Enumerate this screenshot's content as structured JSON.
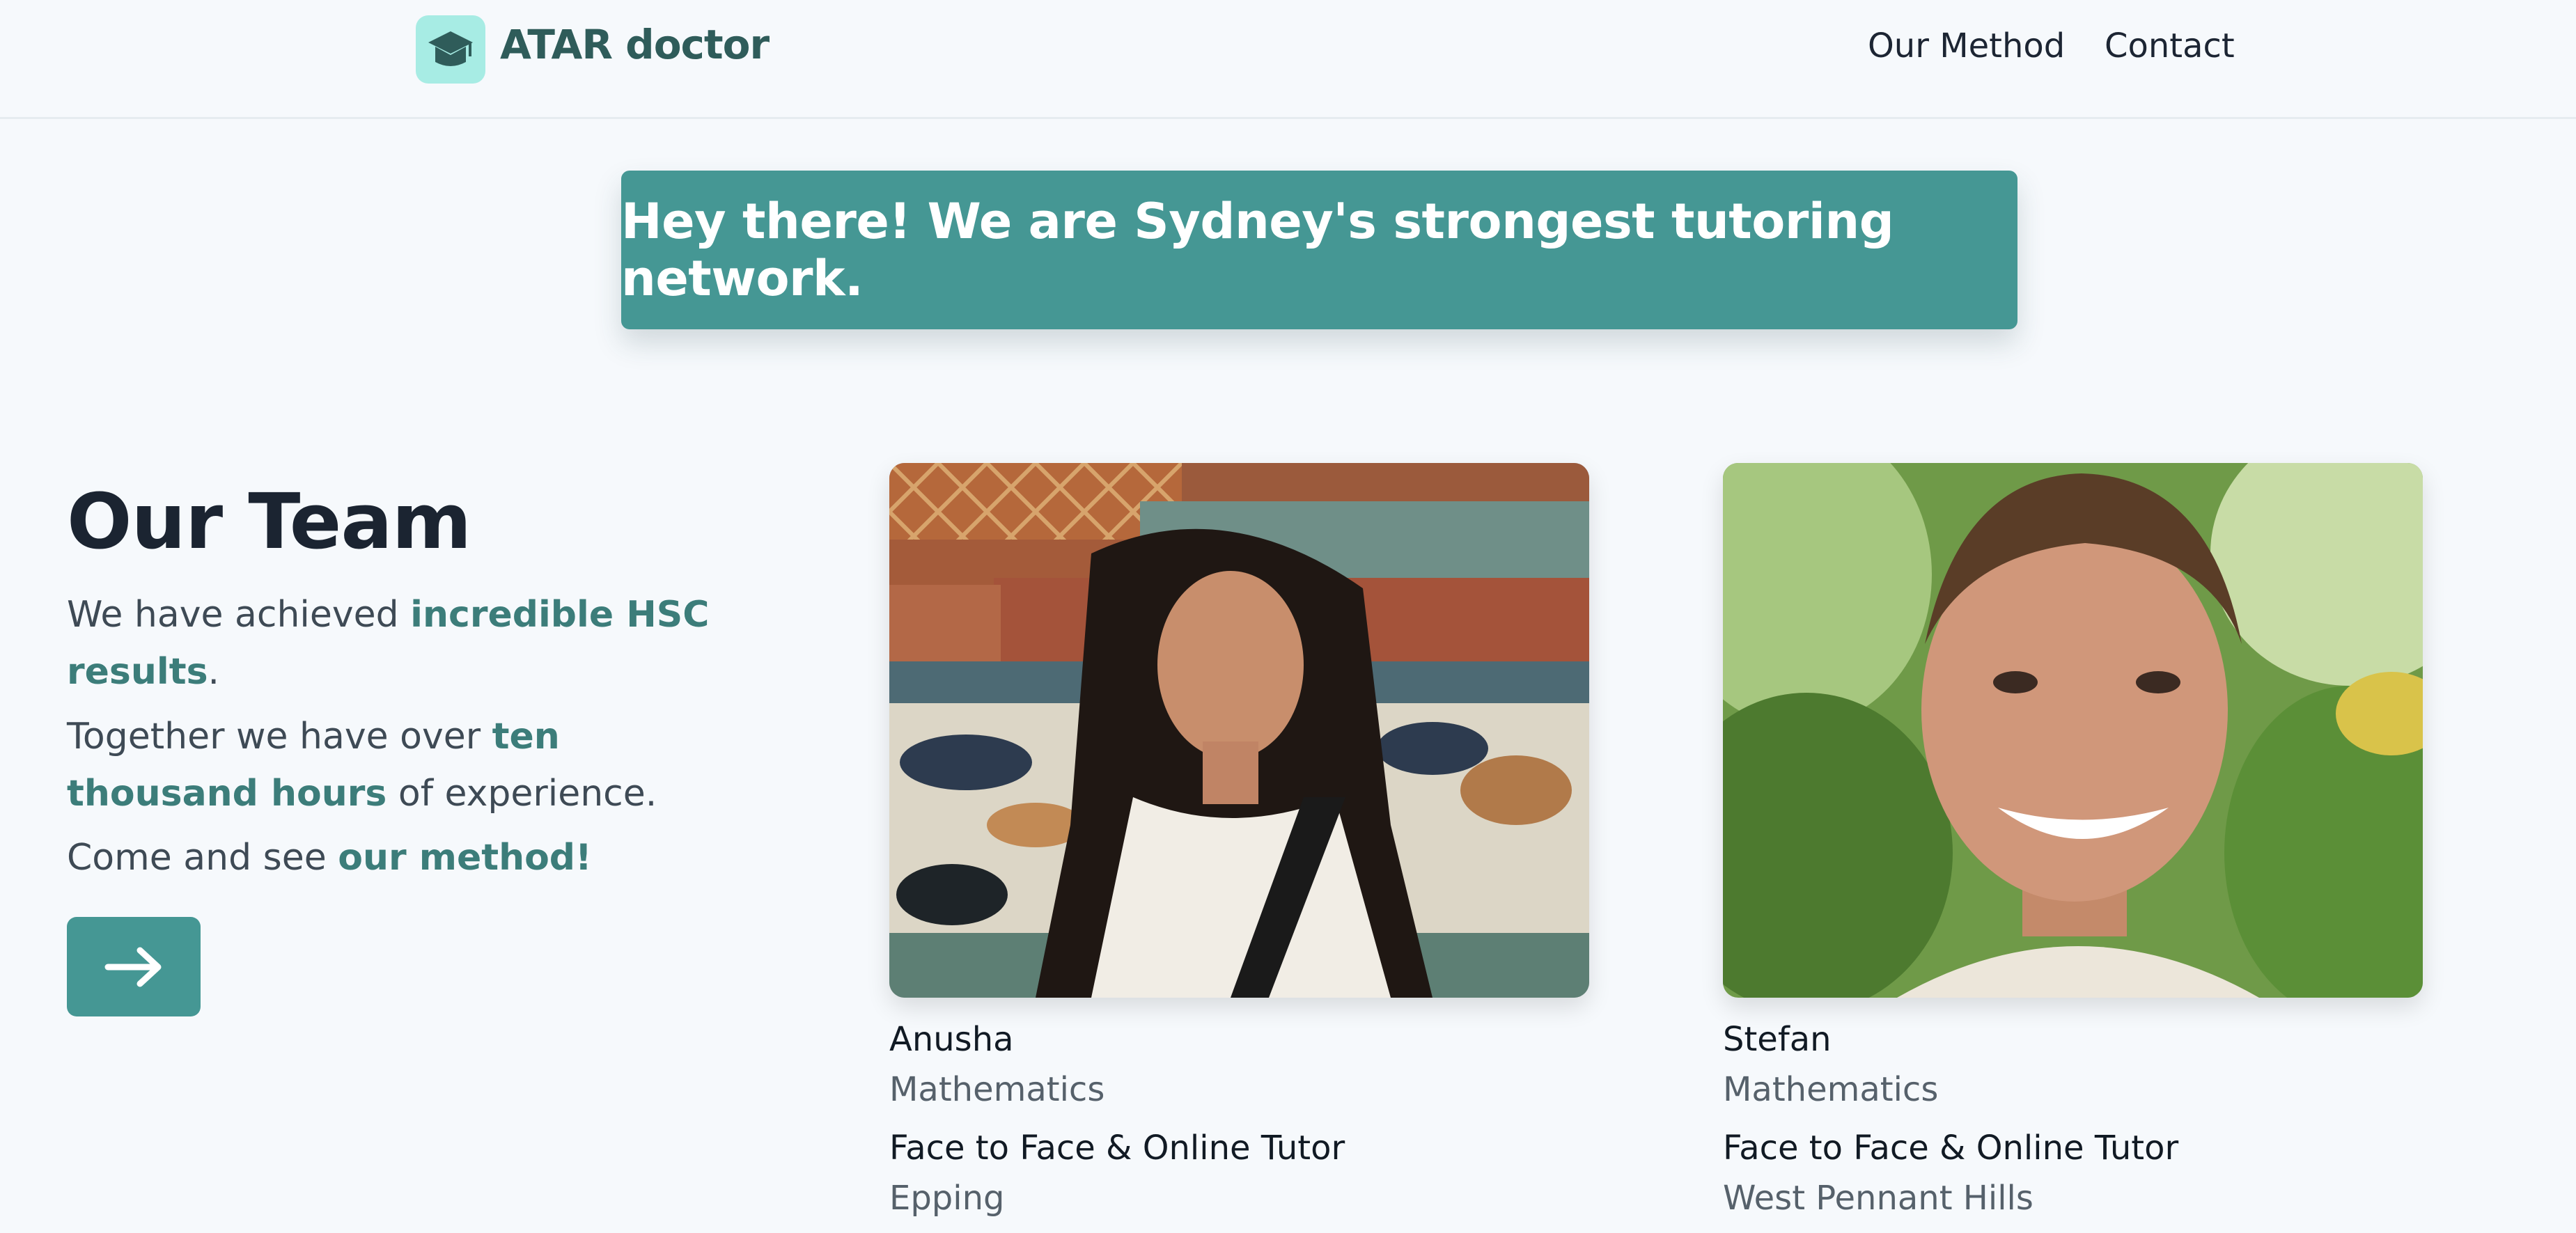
{
  "nav": {
    "brand": "ATAR doctor",
    "links": [
      "Our Method",
      "Contact"
    ]
  },
  "banner": {
    "text": "Hey there! We are Sydney's strongest tutoring network."
  },
  "team": {
    "title": "Our Team",
    "line1_pre": "We have achieved ",
    "line1_hl": "incredible HSC results",
    "line1_post": ".",
    "line2_pre": "Together we have over ",
    "line2_hl": "ten thousand hours",
    "line2_post": " of experience.",
    "line3_pre": "Come and see ",
    "line3_hl": "our method!"
  },
  "tutors": [
    {
      "name": "Anusha",
      "subject": "Mathematics",
      "mode": "Face to Face & Online Tutor",
      "location": "Epping"
    },
    {
      "name": "Stefan",
      "subject": "Mathematics",
      "mode": "Face to Face & Online Tutor",
      "location": "West Pennant Hills"
    }
  ],
  "colors": {
    "accent": "#459794",
    "accent_text": "#3c7d7a",
    "logo_bg": "#a7ece4",
    "background": "#f6f9fc"
  },
  "icons": {
    "logo": "graduation-cap-icon",
    "cta": "arrow-right-icon"
  }
}
